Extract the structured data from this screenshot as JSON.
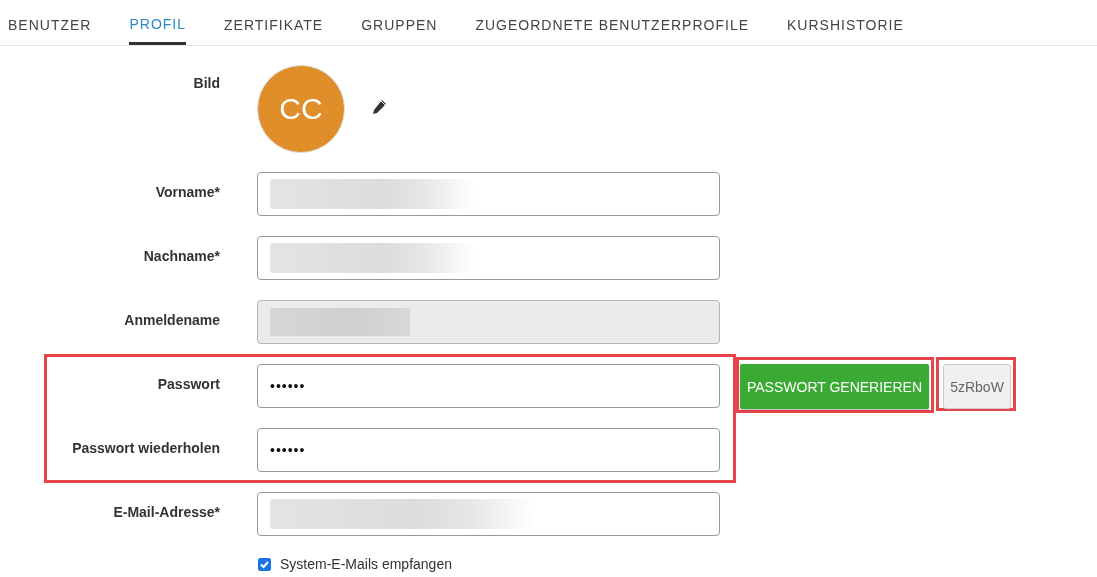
{
  "tabs": [
    {
      "label": "BENUTZER",
      "selected": false
    },
    {
      "label": "PROFIL",
      "selected": true
    },
    {
      "label": "ZERTIFIKATE",
      "selected": false
    },
    {
      "label": "GRUPPEN",
      "selected": false
    },
    {
      "label": "ZUGEORDNETE BENUTZERPROFILE",
      "selected": false
    },
    {
      "label": "KURSHISTORIE",
      "selected": false
    }
  ],
  "picture": {
    "label": "Bild",
    "initials": "CC"
  },
  "fields": [
    {
      "label": "Vorname*",
      "redacted": true,
      "disabled": false
    },
    {
      "label": "Nachname*",
      "redacted": true,
      "disabled": false
    },
    {
      "label": "Anmeldename",
      "redacted": true,
      "disabled": true
    }
  ],
  "password_fields": [
    {
      "label": "Passwort",
      "value": "••••••"
    },
    {
      "label": "Passwort wiederholen",
      "value": "••••••"
    }
  ],
  "generate_button": "PASSWORT GENERIEREN",
  "generated_password": "5zRboW",
  "email_field": {
    "label": "E-Mail-Adresse*",
    "redacted": true
  },
  "system_mails": {
    "label": "System-E-Mails empfangen",
    "checked": true
  }
}
